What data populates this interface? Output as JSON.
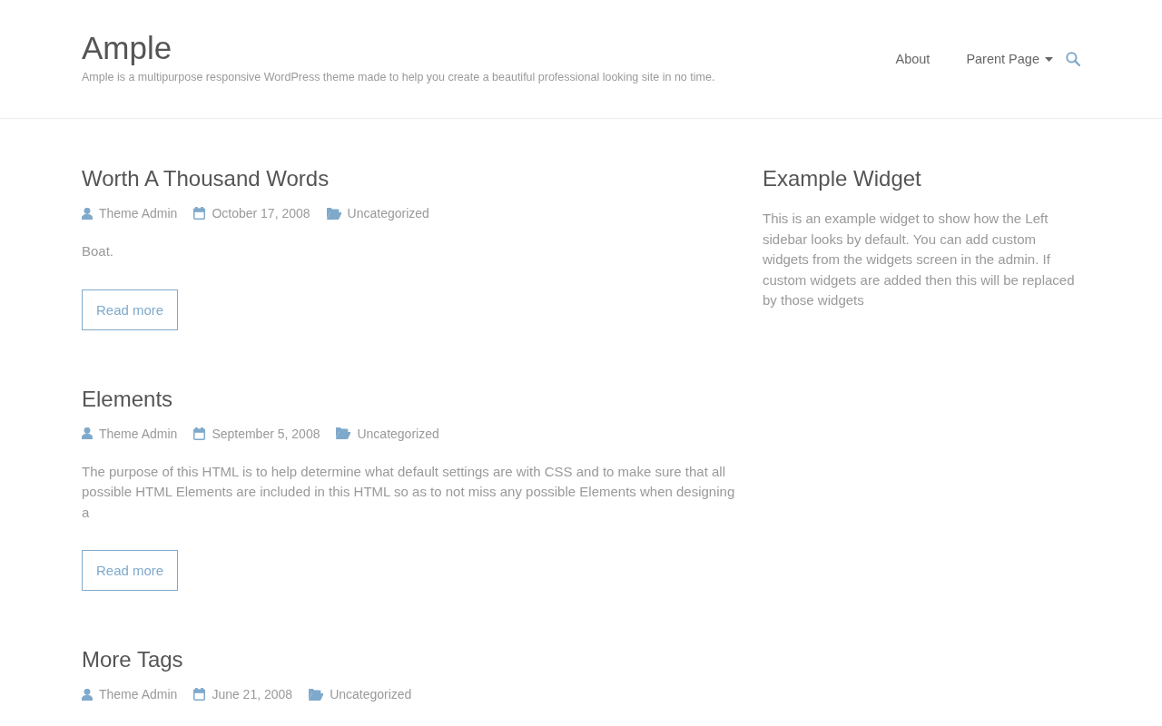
{
  "site": {
    "title": "Ample",
    "tagline": "Ample is a multipurpose responsive WordPress theme made to help you create a beautiful professional looking site in no time."
  },
  "nav": {
    "items": [
      {
        "label": "About",
        "submenu": false
      },
      {
        "label": "Parent Page",
        "submenu": true
      }
    ]
  },
  "posts": [
    {
      "title": "Worth A Thousand Words",
      "author": "Theme Admin",
      "date": "October 17, 2008",
      "category": "Uncategorized",
      "excerpt": "Boat.",
      "button": "Read more"
    },
    {
      "title": "Elements",
      "author": "Theme Admin",
      "date": "September 5, 2008",
      "category": "Uncategorized",
      "excerpt": "The purpose of this HTML is to help determine what default settings are with CSS and to make sure that all possible HTML Elements are included in this HTML so as to not miss any possible Elements when designing a",
      "button": "Read more"
    },
    {
      "title": "More Tags",
      "author": "Theme Admin",
      "date": "June 21, 2008",
      "category": "Uncategorized"
    }
  ],
  "sidebar": {
    "widgets": [
      {
        "title": "Example Widget",
        "text": "This is an example widget to show how the Left sidebar looks by default. You can add custom widgets from the widgets screen in the admin. If custom widgets are added then this will be replaced by those widgets"
      }
    ]
  }
}
